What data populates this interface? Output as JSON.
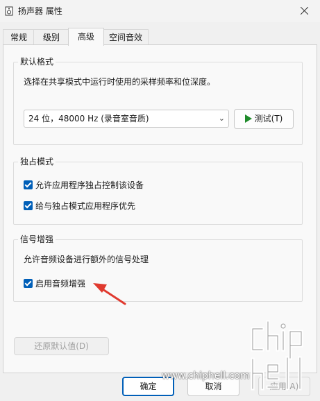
{
  "window": {
    "title": "扬声器 属性"
  },
  "tabs": [
    {
      "label": "常规"
    },
    {
      "label": "级别"
    },
    {
      "label": "高级",
      "active": true
    },
    {
      "label": "空间音效"
    }
  ],
  "default_format": {
    "title": "默认格式",
    "description": "选择在共享模式中运行时使用的采样频率和位深度。",
    "selected": "24 位，48000 Hz (录音室音质)",
    "test_label": "测试(T)"
  },
  "exclusive_mode": {
    "title": "独占模式",
    "options": [
      {
        "label": "允许应用程序独占控制该设备",
        "checked": true
      },
      {
        "label": "给与独占模式应用程序优先",
        "checked": true
      }
    ]
  },
  "signal_enhancements": {
    "title": "信号增强",
    "description": "允许音频设备进行额外的信号处理",
    "options": [
      {
        "label": "启用音频增强",
        "checked": true
      }
    ]
  },
  "restore_defaults_label": "还原默认值(D)",
  "footer": {
    "ok_label": "确定",
    "cancel_label": "取消",
    "apply_label": "应用(A)"
  },
  "watermark": {
    "url": "www.chiphell.com",
    "logo_text": "chip hell"
  },
  "colors": {
    "accent": "#005fb8",
    "annotation_arrow": "#e03a2f",
    "play_icon": "#1e8a2a"
  }
}
